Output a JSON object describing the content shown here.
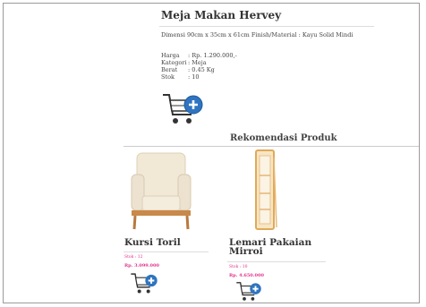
{
  "product": {
    "title": "Meja Makan Hervey",
    "description": "Dimensi 90cm x 35cm x 61cm Finish/Material : Kayu Solid Mindi",
    "specs": [
      {
        "label": "Harga",
        "value": ": Rp. 1.290.000,-"
      },
      {
        "label": "Kategori",
        "value": ": Meja"
      },
      {
        "label": "Berat",
        "value": ": 0.45 Kg"
      },
      {
        "label": "Stok",
        "value": ": 10"
      }
    ],
    "cart_icon": "add-to-cart-icon"
  },
  "recommendations": {
    "title": "Rekomendasi Produk",
    "items": [
      {
        "name": "Kursi Toril",
        "stock": "Stok : 12",
        "price": "Rp. 3.099.000",
        "image_icon": "armchair-image"
      },
      {
        "name": "Lemari Pakaian Mirroi",
        "stock": "Stok : 10",
        "price": "Rp. 4.650.000",
        "image_icon": "wardrobe-mirror-image"
      }
    ]
  },
  "colors": {
    "price_accent": "#e0308a",
    "cart_plus": "#2f74c0"
  }
}
